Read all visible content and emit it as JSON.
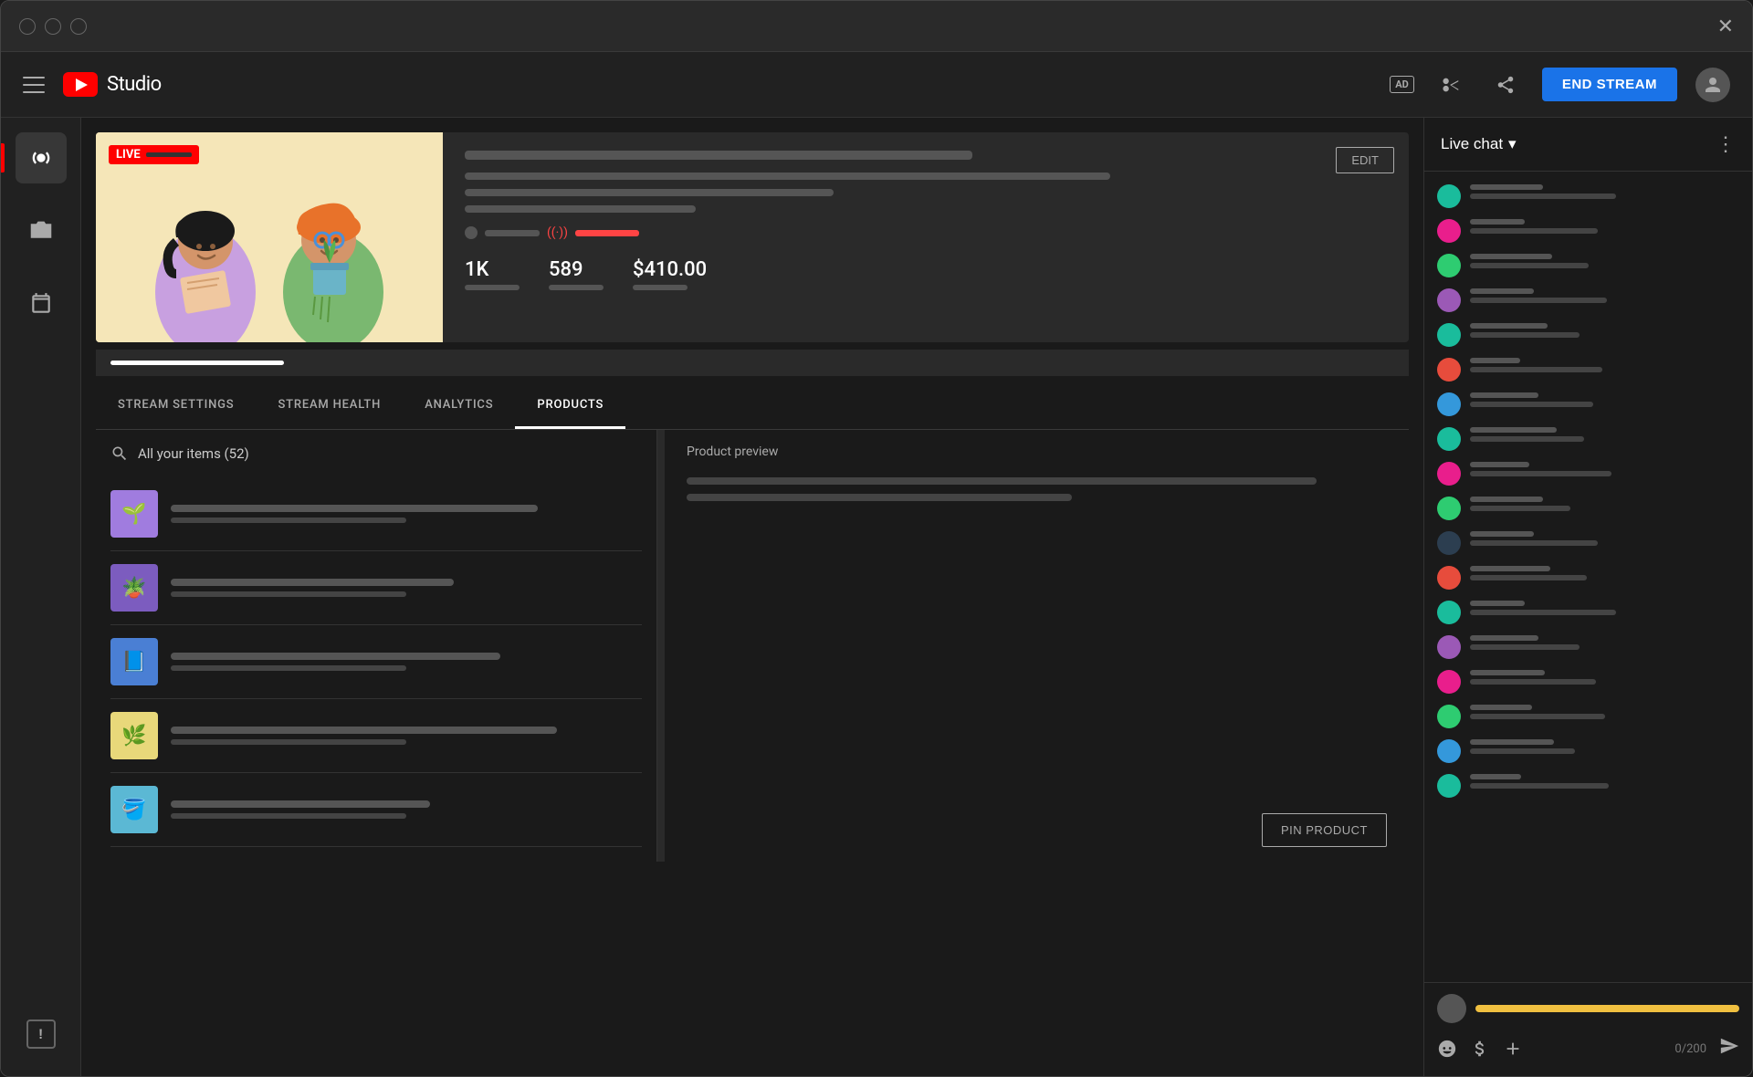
{
  "window": {
    "title": "YouTube Studio"
  },
  "topNav": {
    "logoText": "Studio",
    "adBadge": "AD",
    "endStreamLabel": "END STREAM"
  },
  "streamInfo": {
    "editLabel": "EDIT",
    "stats": {
      "viewers": "1K",
      "likes": "589",
      "revenue": "$410.00"
    }
  },
  "tabs": {
    "items": [
      {
        "id": "stream-settings",
        "label": "STREAM SETTINGS",
        "active": false
      },
      {
        "id": "stream-health",
        "label": "STREAM HEALTH",
        "active": false
      },
      {
        "id": "analytics",
        "label": "ANALYTICS",
        "active": false
      },
      {
        "id": "products",
        "label": "PRODUCTS",
        "active": true
      }
    ]
  },
  "productsPanel": {
    "searchPlaceholder": "All your items (52)",
    "pinProductLabel": "PIN PRODUCT",
    "previewTitle": "Product preview",
    "products": [
      {
        "id": 1,
        "bg": "#a07cdf",
        "emoji": "🌱"
      },
      {
        "id": 2,
        "bg": "#7c5cbf",
        "emoji": "🪴"
      },
      {
        "id": 3,
        "bg": "#4a7fd4",
        "emoji": "📘"
      },
      {
        "id": 4,
        "bg": "#e8d97a",
        "emoji": "🌿"
      },
      {
        "id": 5,
        "bg": "#5bb8d4",
        "emoji": "🪣"
      }
    ]
  },
  "liveChat": {
    "title": "Live chat",
    "dropdownIcon": "▾",
    "moreIcon": "⋮",
    "inputCounter": "0/200",
    "messages": [
      {
        "avatarColor": "#1abc9c",
        "nameWidth": "80px",
        "textWidth": "160px"
      },
      {
        "avatarColor": "#e91e8c",
        "nameWidth": "60px",
        "textWidth": "140px"
      },
      {
        "avatarColor": "#2ecc71",
        "nameWidth": "90px",
        "textWidth": "130px"
      },
      {
        "avatarColor": "#9b59b6",
        "nameWidth": "70px",
        "textWidth": "150px"
      },
      {
        "avatarColor": "#1abc9c",
        "nameWidth": "85px",
        "textWidth": "120px"
      },
      {
        "avatarColor": "#e74c3c",
        "nameWidth": "55px",
        "textWidth": "145px"
      },
      {
        "avatarColor": "#3498db",
        "nameWidth": "75px",
        "textWidth": "135px"
      },
      {
        "avatarColor": "#1abc9c",
        "nameWidth": "95px",
        "textWidth": "125px"
      },
      {
        "avatarColor": "#e91e8c",
        "nameWidth": "65px",
        "textWidth": "155px"
      },
      {
        "avatarColor": "#2ecc71",
        "nameWidth": "80px",
        "textWidth": "110px"
      },
      {
        "avatarColor": "#2c3e50",
        "nameWidth": "70px",
        "textWidth": "140px"
      },
      {
        "avatarColor": "#e74c3c",
        "nameWidth": "88px",
        "textWidth": "128px"
      },
      {
        "avatarColor": "#1abc9c",
        "nameWidth": "60px",
        "textWidth": "160px"
      },
      {
        "avatarColor": "#9b59b6",
        "nameWidth": "75px",
        "textWidth": "120px"
      },
      {
        "avatarColor": "#e91e8c",
        "nameWidth": "82px",
        "textWidth": "138px"
      },
      {
        "avatarColor": "#2ecc71",
        "nameWidth": "68px",
        "textWidth": "148px"
      },
      {
        "avatarColor": "#3498db",
        "nameWidth": "92px",
        "textWidth": "115px"
      },
      {
        "avatarColor": "#1abc9c",
        "nameWidth": "56px",
        "textWidth": "152px"
      }
    ]
  },
  "sidebar": {
    "items": [
      {
        "id": "live",
        "icon": "((·))",
        "active": true
      },
      {
        "id": "camera",
        "icon": "📷",
        "active": false
      },
      {
        "id": "calendar",
        "icon": "📅",
        "active": false
      }
    ],
    "feedbackIcon": "!"
  }
}
